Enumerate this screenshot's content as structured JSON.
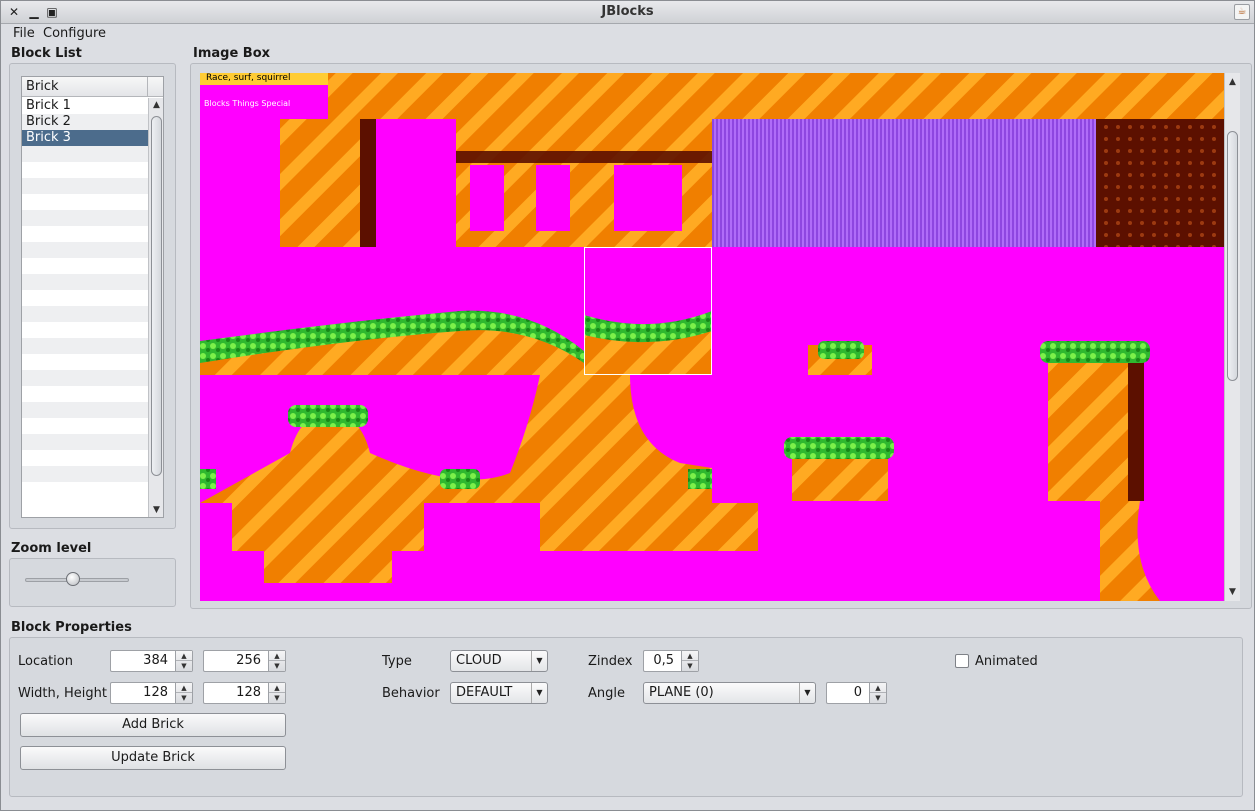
{
  "window": {
    "title": "JBlocks"
  },
  "menu": {
    "file": "File",
    "configure": "Configure"
  },
  "block_list": {
    "title": "Block List",
    "column_header": "Brick",
    "items": [
      "Brick 1",
      "Brick 2",
      "Brick 3"
    ],
    "selected": "Brick 3"
  },
  "zoom": {
    "title": "Zoom level",
    "level": 0.45
  },
  "image_box": {
    "title": "Image Box",
    "sprite_text_1": "Race, surf, squirrel",
    "sprite_text_2": "Blocks  Things  Special"
  },
  "properties": {
    "title": "Block Properties",
    "location_label": "Location",
    "location_x": "384",
    "location_y": "256",
    "size_label": "Width, Height",
    "width": "128",
    "height": "128",
    "add_label": "Add Brick",
    "update_label": "Update Brick",
    "type_label": "Type",
    "type_value": "CLOUD",
    "behavior_label": "Behavior",
    "behavior_value": "DEFAULT",
    "zindex_label": "Zindex",
    "zindex_value": "0,5",
    "angle_label": "Angle",
    "angle_value": "PLANE (0)",
    "angle_number": "0",
    "animated_label": "Animated",
    "animated_checked": false
  },
  "colors": {
    "accent_selection": "#4c6c8c",
    "sprite_background": "#ff00ff",
    "sprite_orange": "#f07f00",
    "sprite_yellow": "#ffaa22",
    "sprite_grass": "#33cc33",
    "sprite_purple": "#a05af0",
    "sprite_darkred": "#5c1000"
  }
}
